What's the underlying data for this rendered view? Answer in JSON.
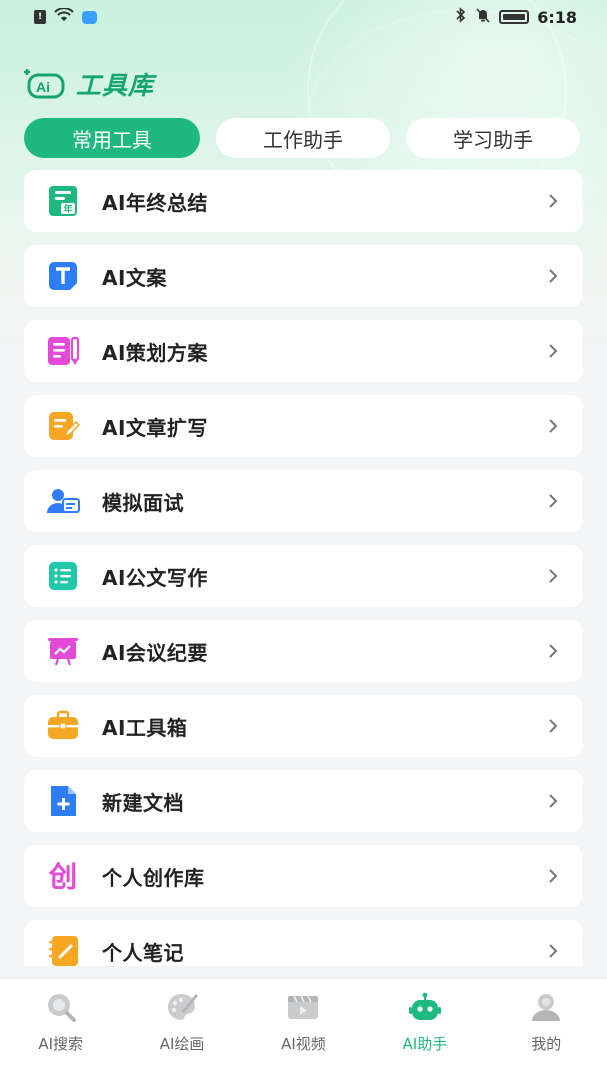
{
  "status_bar": {
    "time": "6:18",
    "icons": [
      "sim-icon",
      "wifi-icon",
      "chat-icon",
      "bluetooth-icon",
      "mute-icon",
      "battery-icon"
    ]
  },
  "header": {
    "logo_text": "Ai",
    "title": "工具库"
  },
  "tabs": [
    {
      "label": "常用工具",
      "active": true
    },
    {
      "label": "工作助手",
      "active": false
    },
    {
      "label": "学习助手",
      "active": false
    }
  ],
  "tools": [
    {
      "label": "AI年终总结",
      "icon": "year-summary-icon",
      "color": "#1fb87e"
    },
    {
      "label": "AI文案",
      "icon": "text-t-icon",
      "color": "#2f7df6"
    },
    {
      "label": "AI策划方案",
      "icon": "plan-pencil-icon",
      "color": "#e34ad6"
    },
    {
      "label": "AI文章扩写",
      "icon": "article-edit-icon",
      "color": "#f5a623"
    },
    {
      "label": "模拟面试",
      "icon": "interview-icon",
      "color": "#2f7df6"
    },
    {
      "label": "AI公文写作",
      "icon": "document-list-icon",
      "color": "#22c7a9"
    },
    {
      "label": "AI会议纪要",
      "icon": "meeting-board-icon",
      "color": "#e34ad6"
    },
    {
      "label": "AI工具箱",
      "icon": "toolbox-icon",
      "color": "#f5a623"
    },
    {
      "label": "新建文档",
      "icon": "new-doc-icon",
      "color": "#2f7df6"
    },
    {
      "label": "个人创作库",
      "icon": "creation-icon",
      "color": "#e34ad6"
    },
    {
      "label": "个人笔记",
      "icon": "notebook-icon",
      "color": "#f5a623"
    }
  ],
  "bottom_nav": [
    {
      "label": "AI搜索",
      "icon": "search-icon",
      "active": false
    },
    {
      "label": "AI绘画",
      "icon": "palette-icon",
      "active": false
    },
    {
      "label": "AI视频",
      "icon": "video-icon",
      "active": false
    },
    {
      "label": "AI助手",
      "icon": "robot-icon",
      "active": true
    },
    {
      "label": "我的",
      "icon": "profile-icon",
      "active": false
    }
  ],
  "colors": {
    "accent": "#1fb87e",
    "background": "#f4f5f6"
  }
}
